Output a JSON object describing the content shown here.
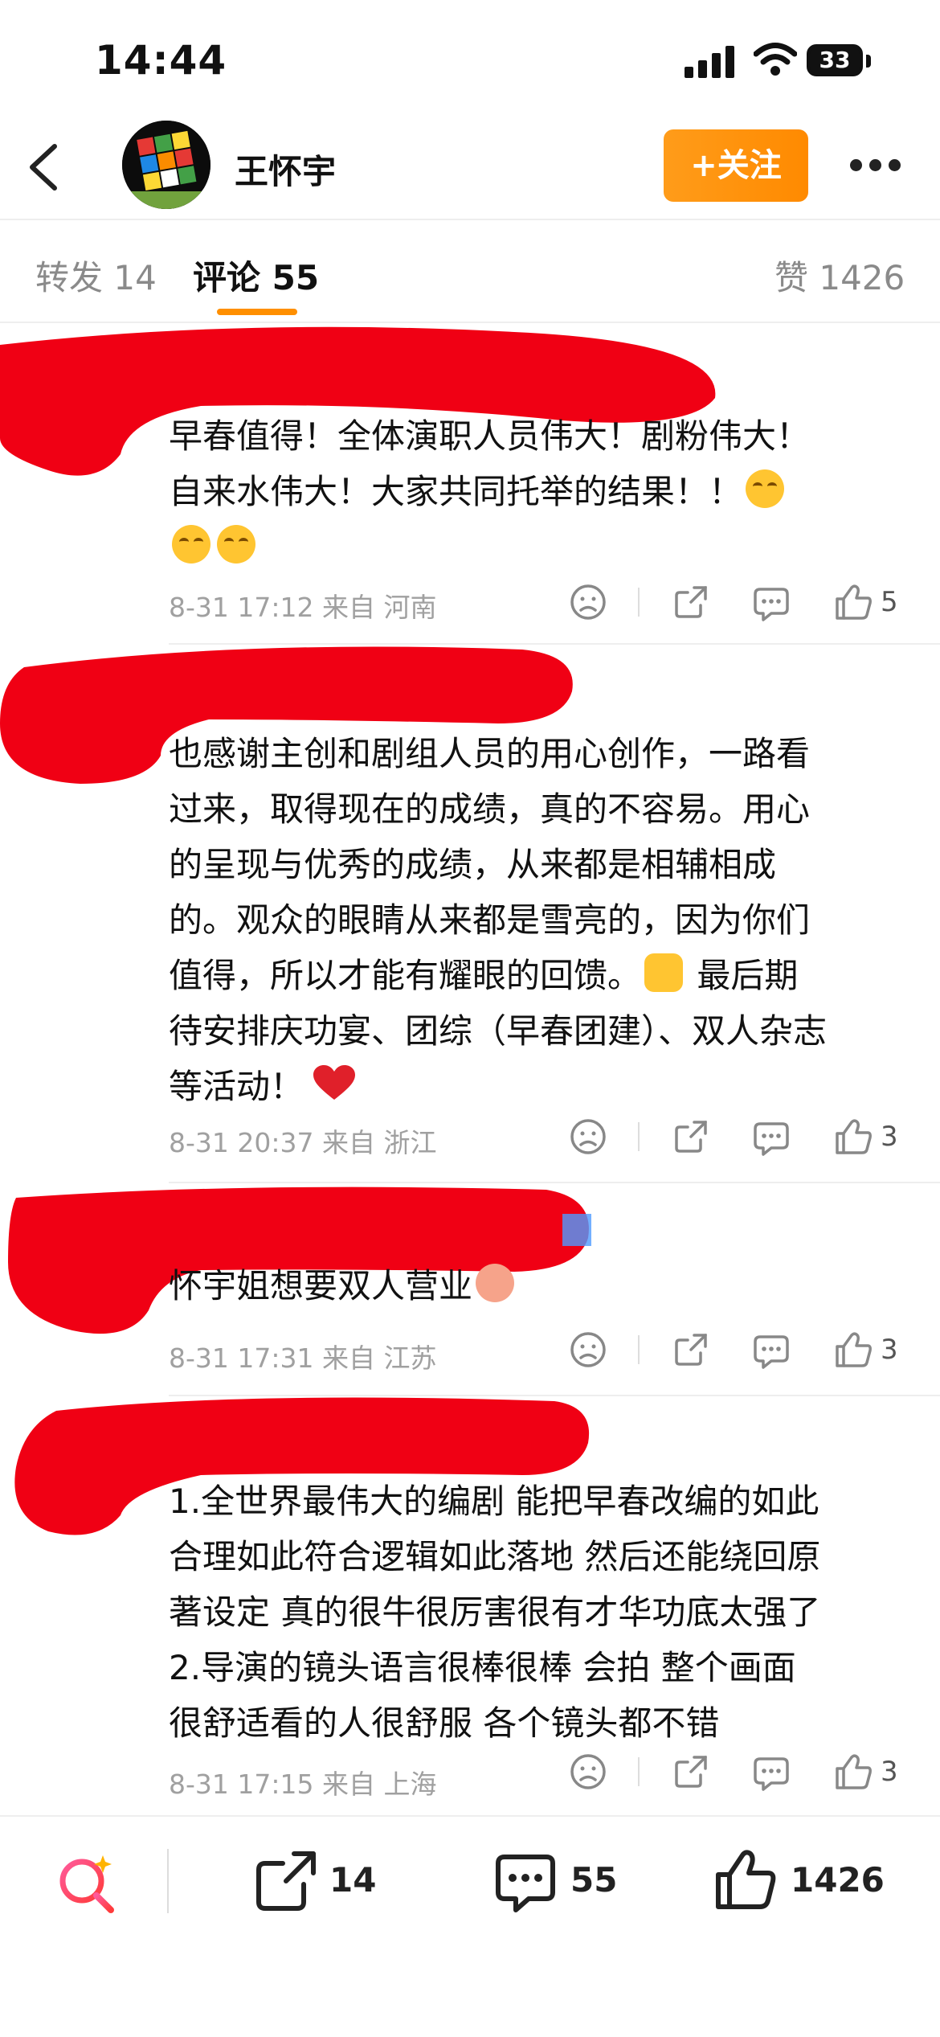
{
  "status_bar": {
    "time": "14:44",
    "battery": "33"
  },
  "header": {
    "user_name": "王怀宇",
    "follow_label": "+关注"
  },
  "tabs": {
    "repost": "转发 14",
    "comments": "评论 55",
    "likes": "赞 1426"
  },
  "comments": [
    {
      "lines": [
        "早春值得！全体演职人员伟大！剧粉伟大！",
        "自来水伟大！大家共同托举的结果！！"
      ],
      "emoji_note": "laughing-crying emoji ×3",
      "meta": "8-31 17:12  来自 河南",
      "likes": "5"
    },
    {
      "lines": [
        "也感谢主创和剧组人员的用心创作，一路看",
        "过来，取得现在的成绩，真的不容易。用心",
        "的呈现与优秀的成绩，从来都是相辅相成",
        "的。观众的眼睛从来都是雪亮的，因为你们",
        "值得，所以才能有耀眼的回馈。",
        "待安排庆功宴、团综（早春团建）、双人杂志",
        "等活动！"
      ],
      "line5_tail": "最后期",
      "meta": "8-31 20:37  来自 浙江",
      "likes": "3"
    },
    {
      "lines": [
        "怀宇姐想要双人营业"
      ],
      "meta": "8-31 17:31  来自 江苏",
      "likes": "3"
    },
    {
      "lines": [
        "1.全世界最伟大的编剧 能把早春改编的如此",
        "合理如此符合逻辑如此落地 然后还能绕回原",
        "著设定 真的很牛很厉害很有才华功底太强了",
        "2.导演的镜头语言很棒很棒 会拍 整个画面",
        "很舒适看的人很舒服 各个镜头都不错"
      ],
      "meta": "8-31 17:15  来自 上海",
      "likes": "3"
    }
  ],
  "bottom_bar": {
    "repost_count": "14",
    "comment_count": "55",
    "like_count": "1426"
  },
  "colors": {
    "accent": "#ff8f00",
    "redaction": "#f00014",
    "follow": "#ff9800"
  }
}
